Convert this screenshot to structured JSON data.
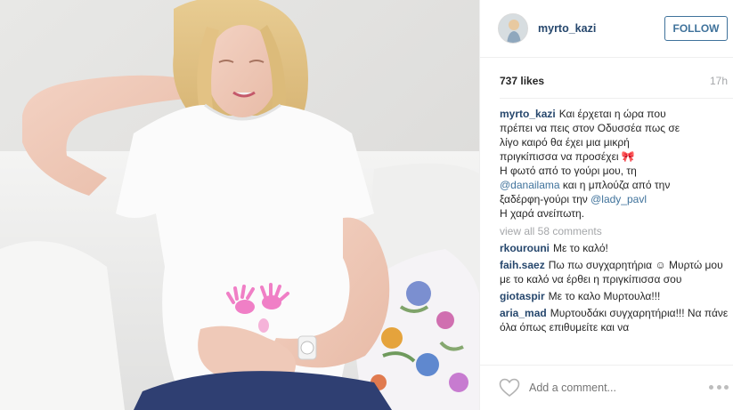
{
  "post": {
    "image_alt": "Pregnant woman in white t-shirt with pink hand prints sitting on a sofa"
  },
  "header": {
    "username": "myrto_kazi",
    "follow_label": "FOLLOW"
  },
  "stats": {
    "likes": "737 likes",
    "time": "17h"
  },
  "caption": {
    "username": "myrto_kazi",
    "line1": "Και έρχεται η ώρα που",
    "line2": "πρέπει να πεις στον Οδυσσέα πως σε",
    "line3": "λίγο καιρό θα έχει μια μικρή",
    "line4": "πριγκίπισσα να προσέχει 🎀",
    "line5": "Η φωτό από το γούρι μου, τη",
    "mention1": "@danailama",
    "line6": " και η μπλούζα από την",
    "line7_prefix": "ξαδέρφη-γούρι την ",
    "mention2": "@lady_pavl",
    "line8": "Η χαρά ανείπωτη."
  },
  "view_all": "view all 58 comments",
  "comments": [
    {
      "user": "rkourouni",
      "text": "Με το καλό!"
    },
    {
      "user": "faih.saez",
      "text": "Πω πω συγχαρητήρια ☺ Μυρτώ μου με το καλό να έρθει η πριγκίπισσα σου"
    },
    {
      "user": "giotaspir",
      "text": "Με το καλο Μυρτουλα!!!"
    },
    {
      "user": "aria_mad",
      "text": "Μυρτουδάκι συγχαρητήρια!!! Να πάνε όλα όπως επιθυμείτε και να"
    }
  ],
  "footer": {
    "add_comment_placeholder": "Add a comment..."
  },
  "icons": {
    "heart": "heart-icon",
    "more": "more-options-icon"
  },
  "colors": {
    "link": "#26476d",
    "follow": "#3f729b",
    "muted": "#a5a7aa"
  }
}
